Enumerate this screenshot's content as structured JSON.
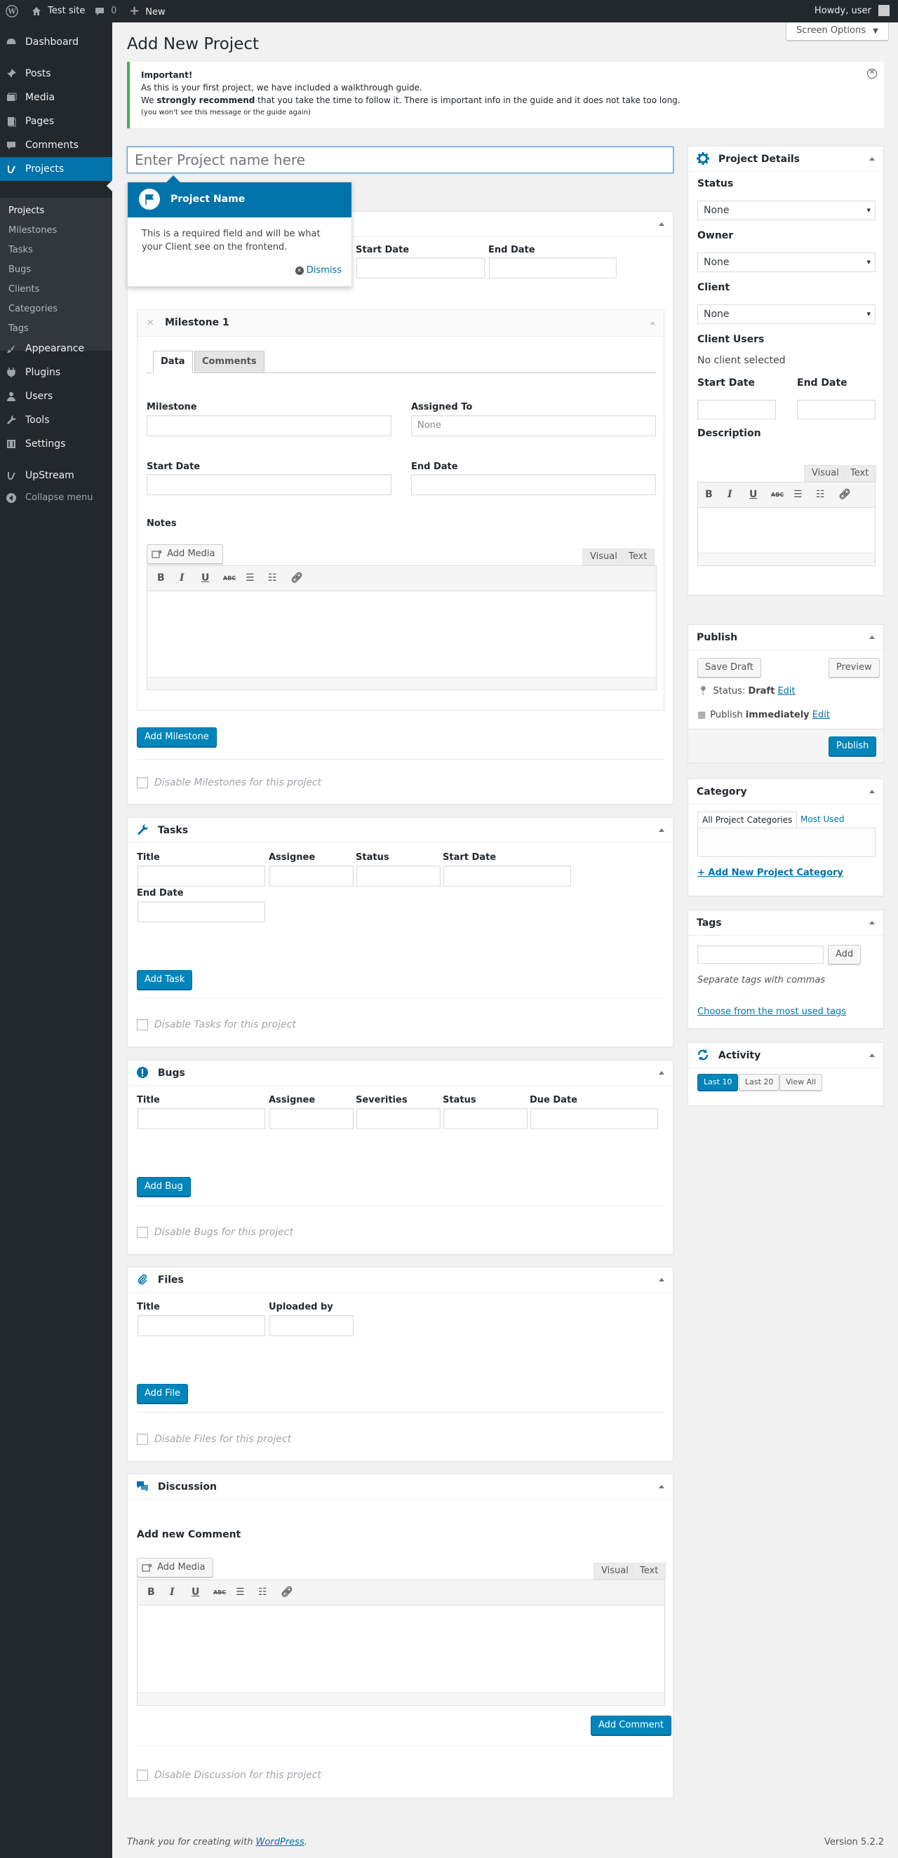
{
  "admin_bar": {
    "site_name": "Test site",
    "comments_count": "0",
    "new_label": "New",
    "howdy": "Howdy, user"
  },
  "sidebar": {
    "items": [
      {
        "label": "Dashboard"
      },
      {
        "label": "Posts"
      },
      {
        "label": "Media"
      },
      {
        "label": "Pages"
      },
      {
        "label": "Comments"
      },
      {
        "label": "Projects"
      },
      {
        "label": "Appearance"
      },
      {
        "label": "Plugins"
      },
      {
        "label": "Users"
      },
      {
        "label": "Tools"
      },
      {
        "label": "Settings"
      },
      {
        "label": "UpStream"
      },
      {
        "label": "Collapse menu"
      }
    ],
    "submenu": [
      "Projects",
      "Milestones",
      "Tasks",
      "Bugs",
      "Clients",
      "Categories",
      "Tags"
    ]
  },
  "page": {
    "title": "Add New Project",
    "screen_options": "Screen Options"
  },
  "notice": {
    "heading": "Important!",
    "line1": "As this is your first project, we have included a walkthrough guide.",
    "line2_pre": "We ",
    "line2_strong": "strongly recommend",
    "line2_post": " that you take the time to follow it. There is important info in the guide and it does not take too long.",
    "line3": "(you won't see this message or the guide again)"
  },
  "title_input": {
    "placeholder": "Enter Project name here"
  },
  "tooltip": {
    "title": "Project Name",
    "text": "This is a required field and will be what your Client see on the frontend.",
    "dismiss": "Dismiss"
  },
  "milestones": {
    "start_date": "Start Date",
    "end_date": "End Date",
    "item_title": "Milestone 1",
    "tabs": [
      "Data",
      "Comments"
    ],
    "milestone_label": "Milestone",
    "assigned_label": "Assigned To",
    "assigned_placeholder": "None",
    "start_label": "Start Date",
    "end_label": "End Date",
    "notes_label": "Notes",
    "add_media": "Add Media",
    "visual": "Visual",
    "text": "Text",
    "add_button": "Add Milestone",
    "disable": "Disable Milestones for this project"
  },
  "tasks": {
    "title": "Tasks",
    "cols": [
      "Title",
      "Assignee",
      "Status",
      "Start Date"
    ],
    "end_date": "End Date",
    "add_button": "Add Task",
    "disable": "Disable Tasks for this project"
  },
  "bugs": {
    "title": "Bugs",
    "cols": [
      "Title",
      "Assignee",
      "Severities",
      "Status",
      "Due Date"
    ],
    "add_button": "Add Bug",
    "disable": "Disable Bugs for this project"
  },
  "files": {
    "title": "Files",
    "cols": [
      "Title",
      "Uploaded by"
    ],
    "add_button": "Add File",
    "disable": "Disable Files for this project"
  },
  "discussion": {
    "title": "Discussion",
    "new_comment": "Add new Comment",
    "add_media": "Add Media",
    "visual": "Visual",
    "text": "Text",
    "add_button": "Add Comment",
    "disable": "Disable Discussion for this project"
  },
  "project_details": {
    "title": "Project Details",
    "status_label": "Status",
    "status_value": "None",
    "owner_label": "Owner",
    "owner_value": "None",
    "client_label": "Client",
    "client_value": "None",
    "client_users_label": "Client Users",
    "client_users_value": "No client selected",
    "start_label": "Start Date",
    "end_label": "End Date",
    "description_label": "Description",
    "visual": "Visual",
    "text": "Text"
  },
  "publish": {
    "title": "Publish",
    "save_draft": "Save Draft",
    "preview": "Preview",
    "status_pre": "Status: ",
    "status_value": "Draft",
    "edit": "Edit",
    "publish_pre": "Publish ",
    "publish_value": "immediately",
    "publish_button": "Publish"
  },
  "category": {
    "title": "Category",
    "tab_all": "All Project Categories",
    "tab_most": "Most Used",
    "add_new": "+ Add New Project Category"
  },
  "tags": {
    "title": "Tags",
    "add": "Add",
    "hint": "Separate tags with commas",
    "choose": "Choose from the most used tags"
  },
  "activity": {
    "title": "Activity",
    "buttons": [
      "Last 10",
      "Last 20",
      "View All"
    ]
  },
  "footer": {
    "thanks_pre": "Thank you for creating with ",
    "wordpress": "WordPress",
    "thanks_post": ".",
    "version": "Version 5.2.2"
  },
  "colors": {
    "accent": "#0073aa",
    "primary_button": "#0085ba",
    "adminbar": "#23282d",
    "notice_border": "#46b450"
  }
}
